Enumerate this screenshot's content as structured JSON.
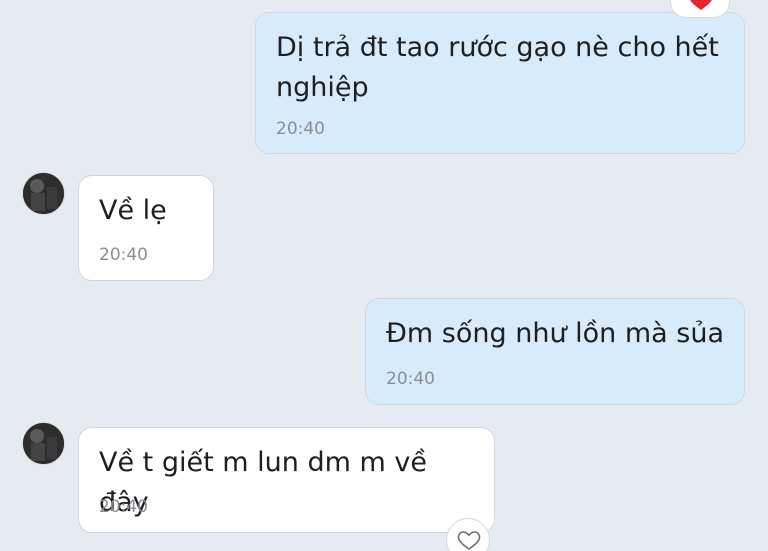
{
  "messages": [
    {
      "sender": "me",
      "text": "Dị trả đt tao rước gạo nè cho hết nghiệp",
      "time": "20:40",
      "reaction": "heart-icon"
    },
    {
      "sender": "other",
      "text": "Về lẹ",
      "time": "20:40"
    },
    {
      "sender": "me",
      "text": "Đm sống như lồn mà sủa",
      "time": "20:40"
    },
    {
      "sender": "other",
      "text": "Về t giết m lun dm m về đây",
      "time": "20:40"
    }
  ],
  "colors": {
    "background": "#e6ebf1",
    "outgoing_bubble": "#d7ebfb",
    "incoming_bubble": "#ffffff",
    "heart": "#e1262d",
    "time_text": "#8a8f96"
  },
  "icons": {
    "reaction_existing": "heart-icon",
    "react_button": "heart-outline-icon"
  }
}
